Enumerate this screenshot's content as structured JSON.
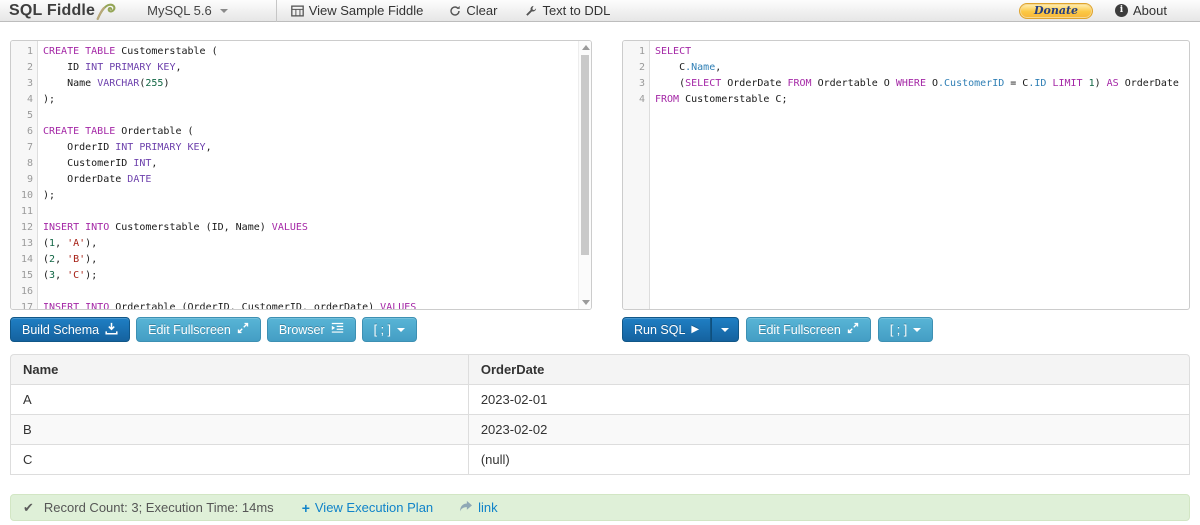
{
  "topbar": {
    "brand": "SQL Fiddle",
    "db_dropdown": "MySQL 5.6",
    "menu": {
      "sample": "View Sample Fiddle",
      "clear": "Clear",
      "ddl": "Text to DDL"
    },
    "donate": "Donate",
    "about": "About"
  },
  "left_editor": {
    "lines": [
      [
        [
          "kw",
          "CREATE TABLE"
        ],
        [
          "pl",
          " Customerstable ("
        ]
      ],
      [
        [
          "pl",
          "    ID "
        ],
        [
          "typ",
          "INT PRIMARY KEY"
        ],
        [
          "pl",
          ","
        ]
      ],
      [
        [
          "pl",
          "    Name "
        ],
        [
          "typ",
          "VARCHAR"
        ],
        [
          "pl",
          "("
        ],
        [
          "num",
          "255"
        ],
        [
          "pl",
          ")"
        ]
      ],
      [
        [
          "pl",
          ");"
        ]
      ],
      [],
      [
        [
          "kw",
          "CREATE TABLE"
        ],
        [
          "pl",
          " Ordertable ("
        ]
      ],
      [
        [
          "pl",
          "    OrderID "
        ],
        [
          "typ",
          "INT PRIMARY KEY"
        ],
        [
          "pl",
          ","
        ]
      ],
      [
        [
          "pl",
          "    CustomerID "
        ],
        [
          "typ",
          "INT"
        ],
        [
          "pl",
          ","
        ]
      ],
      [
        [
          "pl",
          "    OrderDate "
        ],
        [
          "typ",
          "DATE"
        ]
      ],
      [
        [
          "pl",
          ");"
        ]
      ],
      [],
      [
        [
          "kw",
          "INSERT INTO"
        ],
        [
          "pl",
          " Customerstable (ID, Name) "
        ],
        [
          "kw",
          "VALUES"
        ]
      ],
      [
        [
          "pl",
          "("
        ],
        [
          "num",
          "1"
        ],
        [
          "pl",
          ", "
        ],
        [
          "str",
          "'A'"
        ],
        [
          "pl",
          "),"
        ]
      ],
      [
        [
          "pl",
          "("
        ],
        [
          "num",
          "2"
        ],
        [
          "pl",
          ", "
        ],
        [
          "str",
          "'B'"
        ],
        [
          "pl",
          "),"
        ]
      ],
      [
        [
          "pl",
          "("
        ],
        [
          "num",
          "3"
        ],
        [
          "pl",
          ", "
        ],
        [
          "str",
          "'C'"
        ],
        [
          "pl",
          ");"
        ]
      ],
      [],
      [
        [
          "kw",
          "INSERT INTO"
        ],
        [
          "pl",
          " Ordertable (OrderID, CustomerID, orderDate) "
        ],
        [
          "kw",
          "VALUES"
        ]
      ]
    ]
  },
  "right_editor": {
    "lines": [
      [
        [
          "kw",
          "SELECT"
        ]
      ],
      [
        [
          "pl",
          "    C"
        ],
        [
          "prop",
          ".Name"
        ],
        [
          "pl",
          ","
        ]
      ],
      [
        [
          "pl",
          "    ("
        ],
        [
          "kw",
          "SELECT"
        ],
        [
          "pl",
          " OrderDate "
        ],
        [
          "kw",
          "FROM"
        ],
        [
          "pl",
          " Ordertable O "
        ],
        [
          "kw",
          "WHERE"
        ],
        [
          "pl",
          " O"
        ],
        [
          "prop",
          ".CustomerID"
        ],
        [
          "pl",
          " = C"
        ],
        [
          "prop",
          ".ID"
        ],
        [
          "pl",
          " "
        ],
        [
          "kw",
          "LIMIT"
        ],
        [
          "pl",
          " "
        ],
        [
          "num",
          "1"
        ],
        [
          "pl",
          ") "
        ],
        [
          "kw",
          "AS"
        ],
        [
          "pl",
          " OrderDate"
        ]
      ],
      [
        [
          "kw",
          "FROM"
        ],
        [
          "pl",
          " Customerstable C;"
        ]
      ]
    ]
  },
  "left_buttons": {
    "build": "Build Schema",
    "fullscreen": "Edit Fullscreen",
    "browser": "Browser",
    "terminator": "[ ; ]"
  },
  "right_buttons": {
    "run": "Run SQL",
    "fullscreen": "Edit Fullscreen",
    "terminator": "[ ; ]"
  },
  "results": {
    "columns": [
      "Name",
      "OrderDate"
    ],
    "rows": [
      [
        "A",
        "2023-02-01"
      ],
      [
        "B",
        "2023-02-02"
      ],
      [
        "C",
        "(null)"
      ]
    ]
  },
  "statusbar": {
    "summary": "Record Count: 3; Execution Time: 14ms",
    "execution_plan": "View Execution Plan",
    "link_label": "link"
  },
  "colors": {
    "button_primary": "#15629f",
    "button_info": "#449ec4",
    "keyword": "#a427a6",
    "type": "#6e42ad",
    "number": "#116644",
    "string": "#a51d12",
    "property": "#2f7fb5",
    "status_bg": "#dff0d8",
    "link": "#1083c9",
    "donate_bg": "#fcc843"
  }
}
